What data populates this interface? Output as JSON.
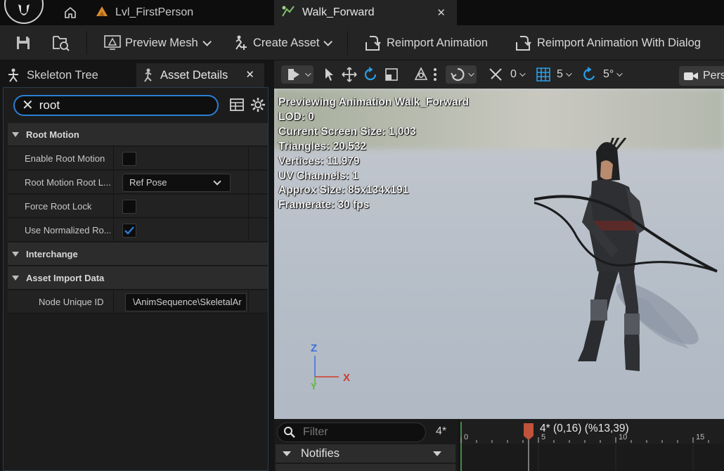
{
  "tabs": {
    "level": "Lvl_FirstPerson",
    "asset": "Walk_Forward",
    "close_glyph": "✕"
  },
  "toolbar": {
    "preview_mesh": "Preview Mesh",
    "create_asset": "Create Asset",
    "reimport": "Reimport Animation",
    "reimport_dialog": "Reimport Animation With Dialog"
  },
  "left_panel": {
    "skeleton_tree_tab": "Skeleton Tree",
    "asset_details_tab": "Asset Details",
    "close_glyph": "✕",
    "search": {
      "value": "root",
      "clear_glyph": "✕"
    },
    "categories": {
      "root_motion": "Root Motion",
      "interchange": "Interchange",
      "asset_import_data": "Asset Import Data"
    },
    "properties": {
      "enable_root_motion": {
        "label": "Enable Root Motion",
        "checked": false
      },
      "root_motion_root_lock": {
        "label": "Root Motion Root L...",
        "value": "Ref Pose"
      },
      "force_root_lock": {
        "label": "Force Root Lock",
        "checked": false
      },
      "use_normalized_root": {
        "label": "Use Normalized Ro...",
        "checked": true
      },
      "node_unique_id": {
        "label": "Node Unique ID",
        "value": "\\AnimSequence\\SkeletalAr"
      }
    }
  },
  "viewport": {
    "toolbar": {
      "grid_snap_angle": "0",
      "grid_size": "5",
      "rotation_snap": "5°",
      "perspective": "Pers"
    },
    "info_lines": [
      "Previewing Animation Walk_Forward",
      "LOD: 0",
      "Current Screen Size: 1,003",
      "Triangles: 20.532",
      "Vertices: 11.979",
      "UV Channels: 1",
      "Approx Size: 85x134x191",
      "Framerate: 30 fps"
    ],
    "axes": {
      "z": "Z",
      "x": "X",
      "y": "Y"
    }
  },
  "timeline": {
    "filter_placeholder": "Filter",
    "frames_label": "4*",
    "notifies_label": "Notifies",
    "scrub_label": "4* (0,16) (%13,39)",
    "tick_labels": [
      "0",
      "5",
      "10",
      "15"
    ]
  },
  "colors": {
    "accent_blue": "#2a7fd4",
    "panel_bg": "#1c1c1c",
    "playhead": "#c0533a",
    "axis_x": "#d23a2a",
    "axis_y": "#5bb53a",
    "axis_z": "#3a6fd8"
  }
}
